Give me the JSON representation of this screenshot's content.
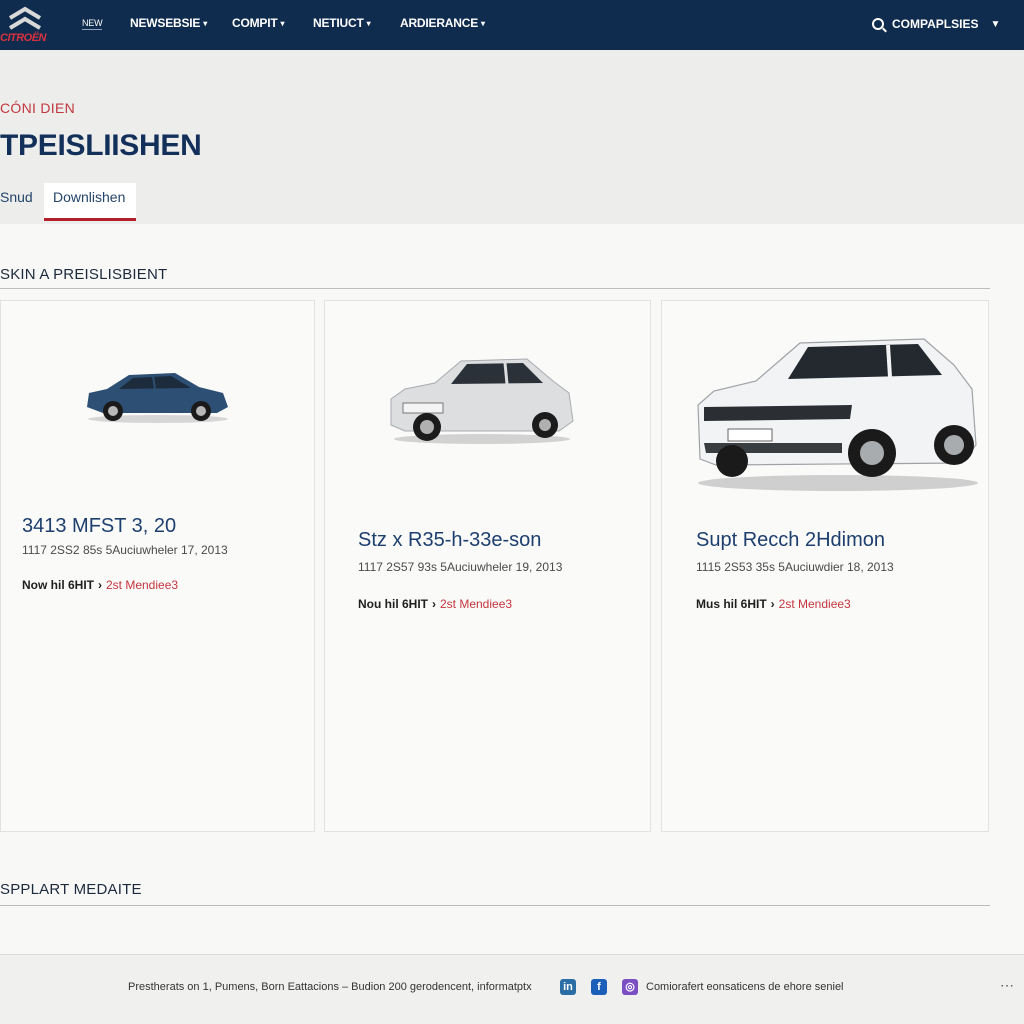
{
  "brand": {
    "logo_text": "CITROËN",
    "accent": "#b3202a",
    "nav_bg": "#0f2c4f"
  },
  "nav": {
    "items": [
      {
        "label": "NEW"
      },
      {
        "label": "NEWSEBSIE"
      },
      {
        "label": "COMPIT"
      },
      {
        "label": "NETIUCT"
      },
      {
        "label": "ARDIERANCE"
      }
    ],
    "search_label": "COMPAPLSIES",
    "search_icon": "search-icon"
  },
  "hero": {
    "eyebrow": "CÓNI DIEN",
    "title": "TPEISLIISHEN",
    "tabs": [
      {
        "label": "Snud"
      },
      {
        "label": "Downlishen"
      }
    ]
  },
  "sections": {
    "first": "SKIN A PREISLISBIENT",
    "second": "SPPLART MEDAITE"
  },
  "cards": [
    {
      "title": "3413 MFST 3, 20",
      "meta": "1117 2SS2 85s  5Auciuwheler 17, 2013",
      "link": "Now hil 6HIT",
      "link_extra": "2st Mendiee3",
      "car_color": "#2d4f73"
    },
    {
      "title": "Stz x R35-h-33e-son",
      "meta": "1117 2S57 93s  5Auciuwheler 19, 2013",
      "link": "Nou hil 6HIT",
      "link_extra": "2st Mendiee3",
      "car_color": "#d9dbdd"
    },
    {
      "title": "Supt Recch 2Hdimon",
      "meta": "1115 2S53 35s  5Auciuwdier 18, 2013",
      "link": "Mus hil 6HIT",
      "link_extra": "2st Mendiee3",
      "car_color": "#f2f3f4"
    }
  ],
  "footer": {
    "text": "Prestherats on 1, Pumens, Born Eattacions – Budion 200 gerodencent, informatptx",
    "social": [
      {
        "icon": "linkedin-icon"
      },
      {
        "icon": "facebook-icon"
      },
      {
        "icon": "instagram-icon"
      }
    ],
    "right_text": "Comiorafert eonsaticens de ehore seniel",
    "more": "⋯"
  }
}
